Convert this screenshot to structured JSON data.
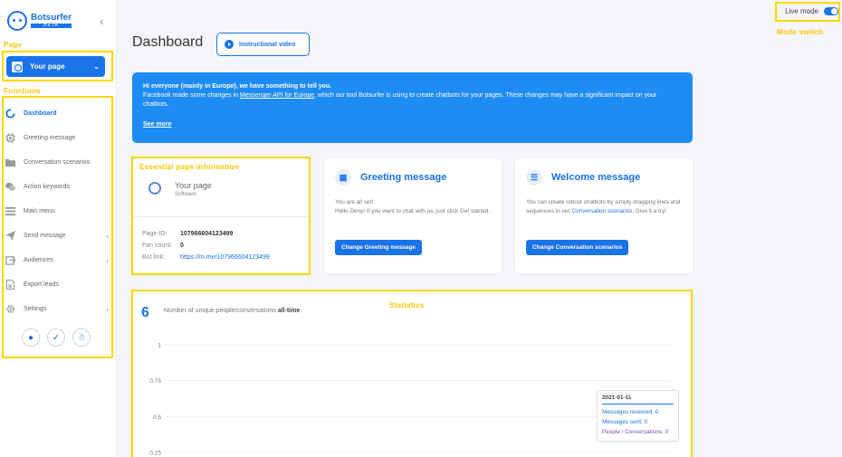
{
  "app": {
    "name": "Botsurfer",
    "badge": "BETA"
  },
  "annotations": {
    "page": "Page",
    "functions": "Functions",
    "essential": "Essential page information",
    "statistics": "Statistics",
    "mode_switch": "Mode switch"
  },
  "sidebar": {
    "page_selector": "Your page",
    "items": [
      {
        "label": "Dashboard",
        "icon": "dashboard-icon",
        "active": true
      },
      {
        "label": "Greeting message",
        "icon": "chip-icon"
      },
      {
        "label": "Conversation scenarios",
        "icon": "folder-icon"
      },
      {
        "label": "Action keywords",
        "icon": "chat-bubbles-icon"
      },
      {
        "label": "Main menu",
        "icon": "menu-icon"
      },
      {
        "label": "Send message",
        "icon": "send-icon",
        "submenu": true
      },
      {
        "label": "Audiences",
        "icon": "audiences-icon",
        "submenu": true
      },
      {
        "label": "Export leads",
        "icon": "export-icon"
      },
      {
        "label": "Settings",
        "icon": "gear-icon",
        "submenu": true
      }
    ]
  },
  "header": {
    "title": "Dashboard",
    "video_button": "Instructional video",
    "live_mode_label": "Live mode",
    "live_mode": true
  },
  "notice": {
    "heading": "Hi everyone (mainly in Europe), we have something to tell you.",
    "text_before": "Facebook made some changes in ",
    "link": "Messenger API for Europe",
    "text_after": ", which our tool Botsurfer is using to create chatbots for your pages. These changes may have a significant impact on your chatbots.",
    "see_more": "See more"
  },
  "page_info": {
    "name": "Your page",
    "category": "Software",
    "page_id_label": "Page ID:",
    "page_id": "107966604123499",
    "fan_count_label": "Fan count:",
    "fan_count": "0",
    "bot_link_label": "Bot link:",
    "bot_link": "https://m.me/107966604123499"
  },
  "greeting_card": {
    "title": "Greeting message",
    "line1": "You are all set!",
    "line2": "Hello Deny! If you want to chat with us, just click Get started.",
    "button": "Change Greeting message"
  },
  "welcome_card": {
    "title": "Welcome message",
    "text_before": "You can create robust chatbots by simply dragging lines and sequences in our ",
    "link": "Conversation scenarios",
    "text_after": ". Give it a try!",
    "button": "Change Conversation scenarios"
  },
  "stats": {
    "count": "6",
    "desc_before": "Number of unique people/conversations ",
    "desc_bold": "all-time",
    "desc_after": ".",
    "tooltip": {
      "date": "2021-01-11",
      "received": "Messages received: 0",
      "sent": "Messages sent: 0",
      "people": "People / Conversations: 0"
    }
  },
  "chart_data": {
    "type": "line",
    "title": "",
    "xlabel": "",
    "ylabel": "",
    "y_ticks": [
      "1",
      "0.75",
      "0.5",
      "0.25"
    ],
    "ylim": [
      0.25,
      1
    ],
    "grid": true
  },
  "colors": {
    "accent": "#1a73e8",
    "notice": "#1e8cf5",
    "annotation": "#ffd600"
  }
}
